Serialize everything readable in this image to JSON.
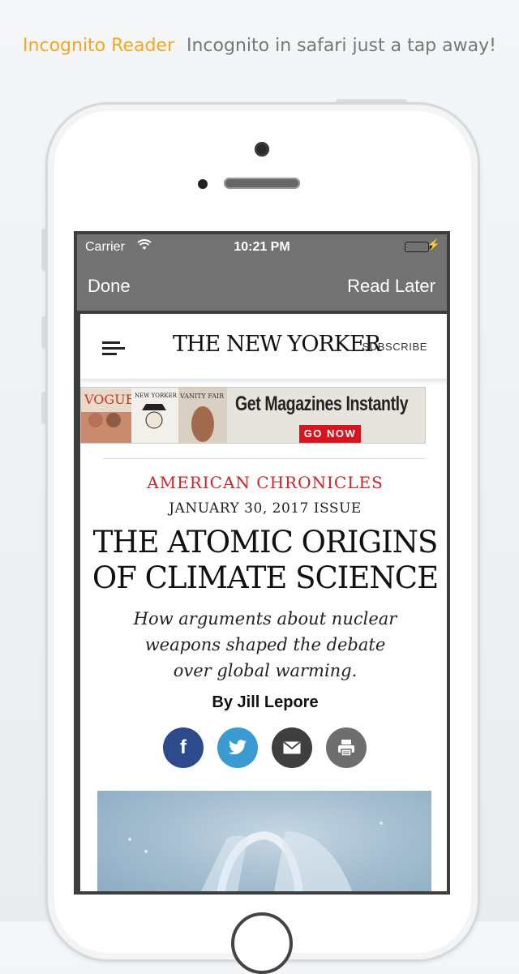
{
  "tagline": {
    "brand": "Incognito Reader",
    "text": "Incognito in safari just a tap away!",
    "brand_color": "#f5a623"
  },
  "status_bar": {
    "carrier": "Carrier",
    "time": "10:21 PM",
    "wifi_icon": "wifi-icon",
    "battery_icon": "battery-icon"
  },
  "nav": {
    "done_label": "Done",
    "read_later_label": "Read Later"
  },
  "site": {
    "menu_icon": "hamburger-icon",
    "logo": "THE NEW YORKER",
    "subscribe_label": "SUBSCRIBE"
  },
  "ad": {
    "headline": "Get Magazines Instantly",
    "cta": "GO NOW",
    "cover_texts": [
      "VOGUE",
      "NEW YORKER",
      "VANITY FAIR"
    ]
  },
  "article": {
    "kicker": "AMERICAN CHRONICLES",
    "issue": "JANUARY 30, 2017 ISSUE",
    "title_line1": "THE ATOMIC ORIGINS",
    "title_line2": "OF CLIMATE SCIENCE",
    "dek": "How arguments about nuclear weapons shaped the debate over global warming.",
    "byline": "By Jill Lepore"
  },
  "share": {
    "facebook": "f",
    "twitter": "twitter-bird-icon",
    "email": "envelope-icon",
    "print": "printer-icon"
  },
  "colors": {
    "kicker": "#d0242a",
    "facebook": "#2d4a8c",
    "twitter": "#3a9bd2",
    "email": "#3f3f3f",
    "print": "#6e6e6e",
    "bar": "#727272"
  }
}
